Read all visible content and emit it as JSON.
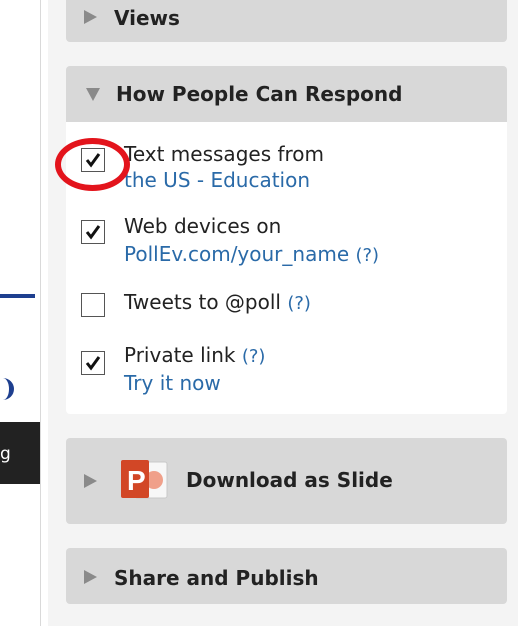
{
  "panels": {
    "views": {
      "label": "Views"
    },
    "respond": {
      "label": "How People Can Respond",
      "options": [
        {
          "line1": "Text messages from",
          "line2": "the US - Education",
          "help": "",
          "checked": true
        },
        {
          "line1": "Web devices on",
          "line2": "PollEv.com/your_name",
          "help": "(?)",
          "checked": true
        },
        {
          "line1": "Tweets to @poll",
          "line2": "",
          "help": "(?)",
          "checked": false
        },
        {
          "line1": "Private link",
          "line2": "Try it now",
          "help": "(?)",
          "checked": true
        }
      ]
    },
    "download": {
      "label": "Download as Slide",
      "icon": "powerpoint-icon"
    },
    "share": {
      "label": "Share and Publish"
    }
  },
  "left_edge": {
    "fragment": "g"
  },
  "colors": {
    "link": "#2a6aa8",
    "highlight": "#e3141c",
    "header_bg": "#d8d8d8"
  }
}
